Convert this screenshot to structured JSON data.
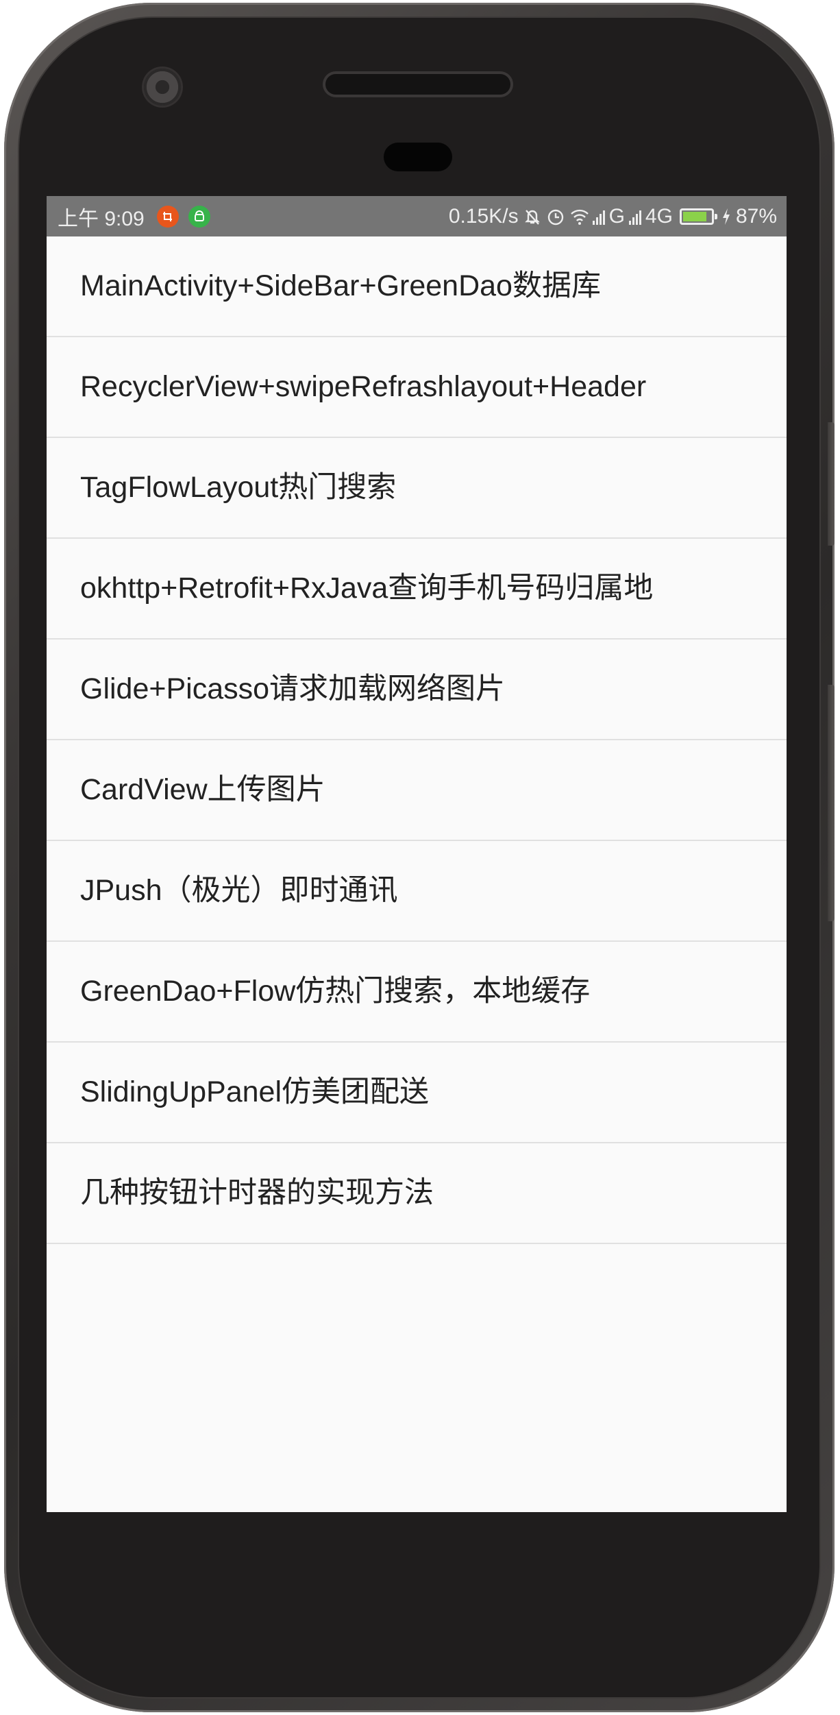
{
  "status_bar": {
    "time": "上午 9:09",
    "network_speed": "0.15K/s",
    "network_type_1": "G",
    "network_type_2": "4G",
    "battery_percent": "87%",
    "battery_level": 0.87,
    "icons": [
      "mute-bell-icon",
      "alarm-icon",
      "wifi-icon",
      "signal-icon",
      "signal-icon",
      "battery-icon",
      "charging-icon"
    ],
    "notification_icons": [
      "screenshot-icon",
      "android-icon"
    ],
    "colors": {
      "background": "#757575",
      "battery_fill": "#8bd14a",
      "notif_orange": "#e8561c",
      "notif_green": "#37b34a"
    }
  },
  "list": {
    "items": [
      {
        "label": "MainActivity+SideBar+GreenDao数据库"
      },
      {
        "label": "RecyclerView+swipeRefrashlayout+Header"
      },
      {
        "label": "TagFlowLayout热门搜索"
      },
      {
        "label": "okhttp+Retrofit+RxJava查询手机号码归属地"
      },
      {
        "label": "Glide+Picasso请求加载网络图片"
      },
      {
        "label": "CardView上传图片"
      },
      {
        "label": "JPush（极光）即时通讯"
      },
      {
        "label": "GreenDao+Flow仿热门搜索，本地缓存"
      },
      {
        "label": "SlidingUpPanel仿美团配送"
      },
      {
        "label": "几种按钮计时器的实现方法"
      }
    ]
  }
}
